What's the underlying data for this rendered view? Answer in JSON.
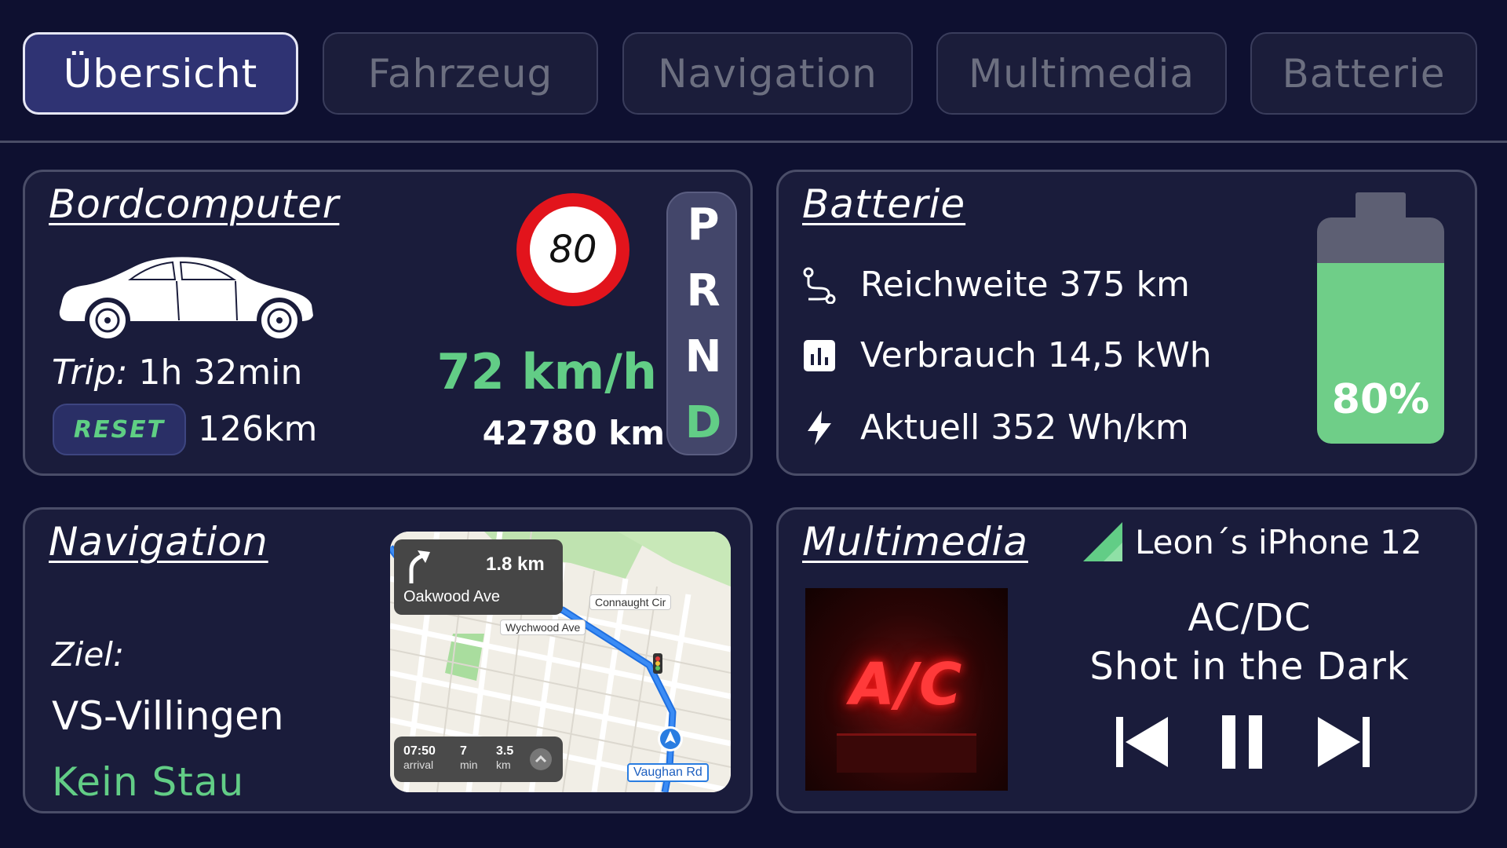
{
  "tabs": [
    {
      "label": "Übersicht",
      "active": true
    },
    {
      "label": "Fahrzeug",
      "active": false
    },
    {
      "label": "Navigation",
      "active": false
    },
    {
      "label": "Multimedia",
      "active": false
    },
    {
      "label": "Batterie",
      "active": false
    }
  ],
  "bordcomputer": {
    "title": "Bordcomputer",
    "trip_label": "Trip:",
    "trip_value": "1h 32min",
    "reset_label": "RESET",
    "trip_distance": "126km",
    "speed_limit": "80",
    "speed": "72 km/h",
    "odometer": "42780 km",
    "gears": [
      "P",
      "R",
      "N",
      "D"
    ],
    "active_gear": "D"
  },
  "batterie": {
    "title": "Batterie",
    "rows": [
      {
        "icon": "route-icon",
        "text": "Reichweite 375 km"
      },
      {
        "icon": "chart-icon",
        "text": "Verbrauch 14,5 kWh"
      },
      {
        "icon": "lightning-icon",
        "text": "Aktuell 352 Wh/km"
      }
    ],
    "level_percent": 80,
    "level_label": "80%"
  },
  "navigation": {
    "title": "Navigation",
    "ziel_label": "Ziel:",
    "ziel_value": "VS-Villingen",
    "traffic_status": "Kein Stau",
    "map": {
      "turn_distance": "1.8 km",
      "turn_street": "Oakwood Ave",
      "street_labels": [
        "Connaught Cir",
        "Wychwood Ave",
        "Vaughan Rd"
      ],
      "eta": [
        {
          "value": "07:50",
          "unit": "arrival"
        },
        {
          "value": "7",
          "unit": "min"
        },
        {
          "value": "3.5",
          "unit": "km"
        }
      ]
    }
  },
  "multimedia": {
    "title": "Multimedia",
    "device": "Leon´s iPhone 12",
    "album_logo": "A/C",
    "artist": "AC/DC",
    "song": "Shot in the Dark"
  },
  "colors": {
    "background": "#0e1030",
    "panel": "#1a1c3b",
    "accent_green": "#62cd86",
    "active_tab": "#2f3373",
    "speed_sign_red": "#e2141c"
  }
}
